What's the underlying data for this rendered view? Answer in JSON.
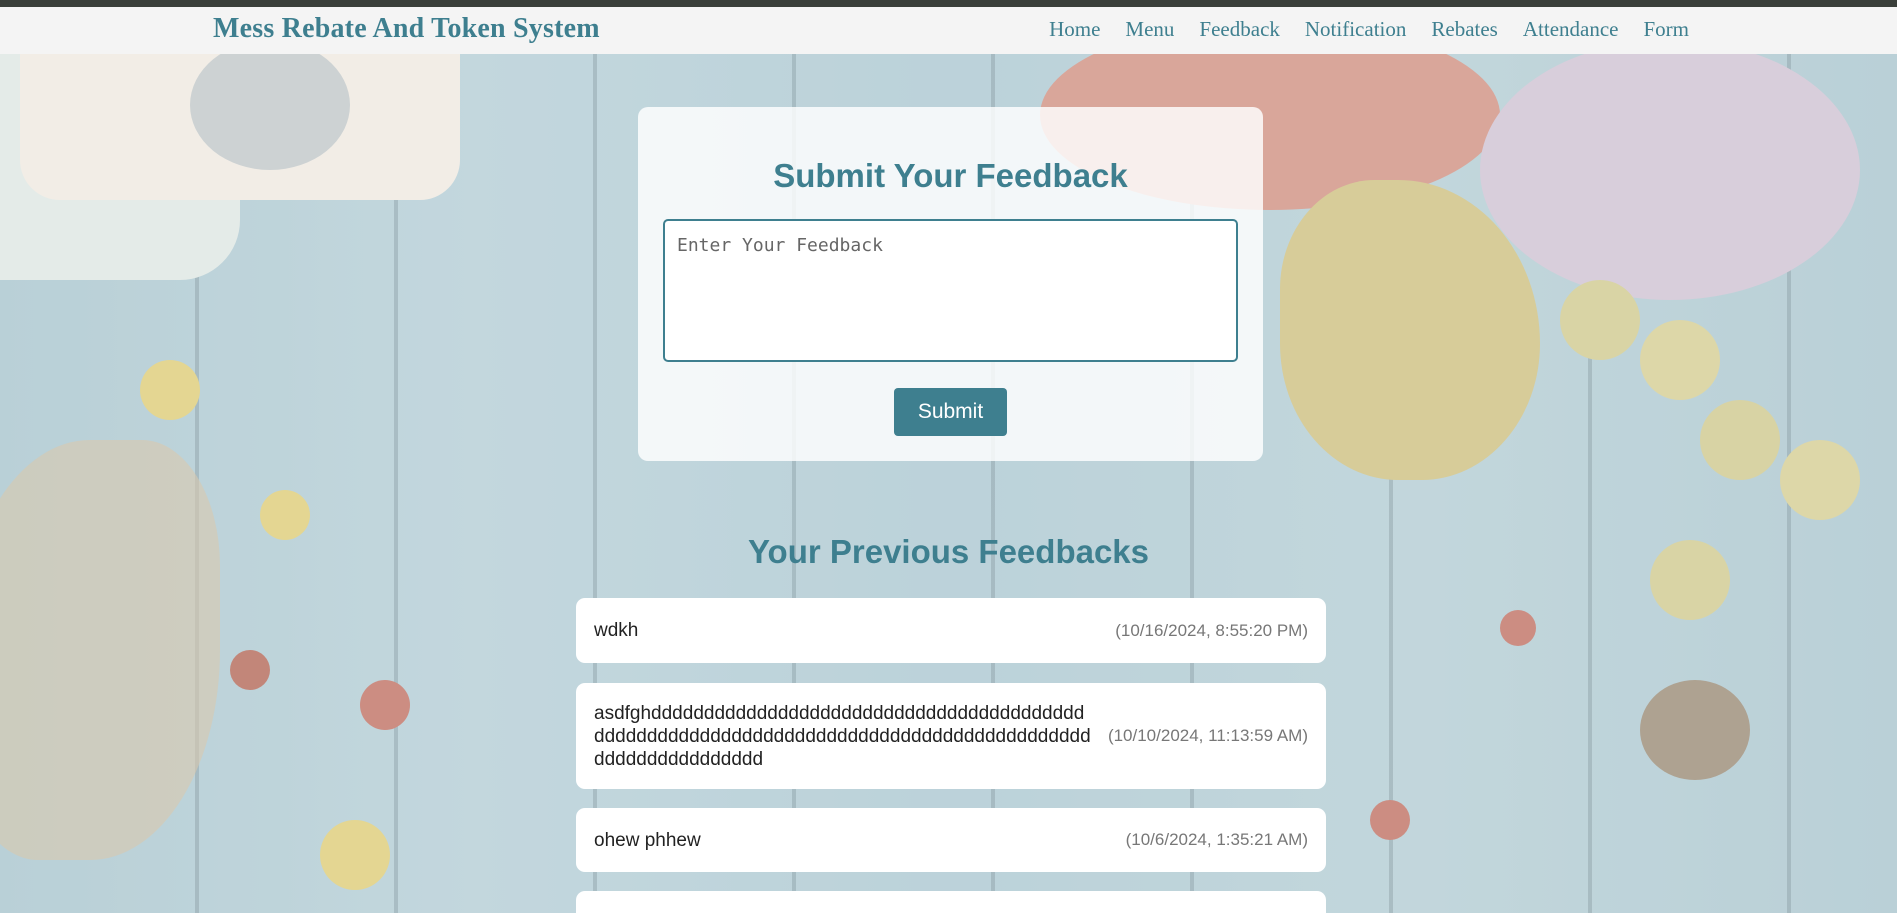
{
  "app": {
    "title": "Mess Rebate And Token System"
  },
  "nav": {
    "items": [
      "Home",
      "Menu",
      "Feedback",
      "Notification",
      "Rebates",
      "Attendance",
      "Form"
    ]
  },
  "form": {
    "title": "Submit Your Feedback",
    "placeholder": "Enter Your Feedback",
    "value": "",
    "submit_label": "Submit"
  },
  "previous": {
    "title": "Your Previous Feedbacks",
    "items": [
      {
        "text": "wdkh",
        "time": "(10/16/2024, 8:55:20 PM)"
      },
      {
        "text": "asdfghdddddddddddddddddddddddddddddddddddddddddddddddddddddddddddddddddddddddddddddddddddddddddddddddddddddddd",
        "time": "(10/10/2024, 11:13:59 AM)"
      },
      {
        "text": "ohew phhew",
        "time": "(10/6/2024, 1:35:21 AM)"
      },
      {
        "text": "",
        "time": ""
      }
    ]
  },
  "colors": {
    "accent": "#3e7f8f",
    "navbar_bg": "#f4f4f4",
    "card_bg": "#ffffff"
  }
}
